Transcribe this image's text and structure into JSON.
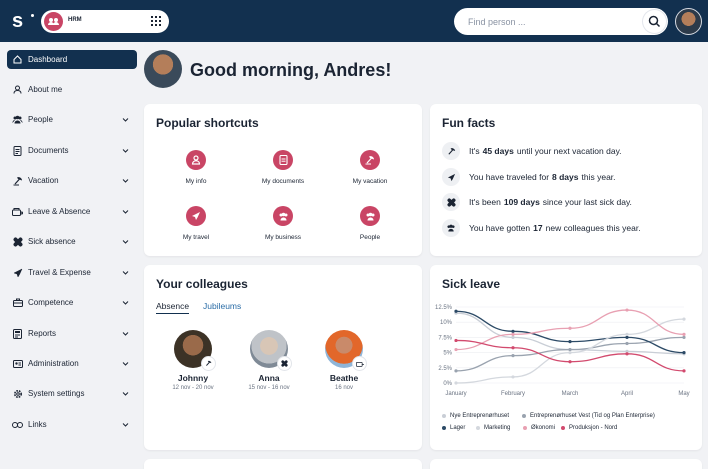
{
  "app": {
    "name": "HRM"
  },
  "search": {
    "placeholder": "Find person ..."
  },
  "sidebar": {
    "items": [
      {
        "label": "Dashboard",
        "icon": "home-icon",
        "active": true
      },
      {
        "label": "About me",
        "icon": "person-icon"
      },
      {
        "label": "People",
        "icon": "people-icon",
        "expandable": true
      },
      {
        "label": "Documents",
        "icon": "document-icon",
        "expandable": true
      },
      {
        "label": "Vacation",
        "icon": "vacation-icon",
        "expandable": true
      },
      {
        "label": "Leave & Absence",
        "icon": "leave-icon",
        "expandable": true
      },
      {
        "label": "Sick absence",
        "icon": "bandage-icon",
        "expandable": true
      },
      {
        "label": "Travel & Expense",
        "icon": "plane-icon",
        "expandable": true
      },
      {
        "label": "Competence",
        "icon": "briefcase-icon",
        "expandable": true
      },
      {
        "label": "Reports",
        "icon": "report-icon",
        "expandable": true
      },
      {
        "label": "Administration",
        "icon": "admin-icon",
        "expandable": true
      },
      {
        "label": "System settings",
        "icon": "gear-icon",
        "expandable": true
      },
      {
        "label": "Links",
        "icon": "link-icon",
        "expandable": true
      }
    ]
  },
  "main": {
    "greeting": "Good morning, Andres!"
  },
  "shortcuts": {
    "title": "Popular shortcuts",
    "items": [
      {
        "label": "My info",
        "icon": "person-icon"
      },
      {
        "label": "My documents",
        "icon": "document-icon"
      },
      {
        "label": "My vacation",
        "icon": "vacation-icon"
      },
      {
        "label": "My travel",
        "icon": "plane-icon"
      },
      {
        "label": "My business",
        "icon": "people-icon"
      },
      {
        "label": "People",
        "icon": "people-icon"
      }
    ]
  },
  "fun_facts": {
    "title": "Fun facts",
    "items": [
      {
        "pre": "It's",
        "bold": "45 days",
        "post": "until your next vacation day.",
        "icon": "vacation-icon"
      },
      {
        "pre": "You have traveled for",
        "bold": "8 days",
        "post": "this year.",
        "icon": "plane-icon"
      },
      {
        "pre": "It's been",
        "bold": "109 days",
        "post": "since your last sick day.",
        "icon": "bandage-icon"
      },
      {
        "pre": "You have gotten",
        "bold": "17",
        "post": "new colleagues this year.",
        "icon": "people-icon"
      }
    ]
  },
  "colleagues": {
    "title": "Your colleagues",
    "tabs": [
      {
        "label": "Absence",
        "active": true
      },
      {
        "label": "Jubileums",
        "active": false
      }
    ],
    "people": [
      {
        "name": "Johnny",
        "dates": "12 nov - 20 nov",
        "badge_icon": "vacation-icon"
      },
      {
        "name": "Anna",
        "dates": "15 nov - 16 nov",
        "badge_icon": "bandage-icon"
      },
      {
        "name": "Beathe",
        "dates": "16 nov",
        "badge_icon": "leave-icon"
      }
    ]
  },
  "sick_leave": {
    "title": "Sick leave"
  },
  "chart_data": {
    "type": "line",
    "title": "Sick leave",
    "x": [
      "January",
      "February",
      "March",
      "April",
      "May"
    ],
    "ylim": [
      0,
      12.5
    ],
    "y_ticks": [
      "0%",
      "2.5%",
      "5%",
      "7.5%",
      "10%",
      "12.5%"
    ],
    "grid": true,
    "legend_position": "bottom",
    "series": [
      {
        "name": "Nye Entreprenørhuset",
        "color": "#c9ced6",
        "values": [
          11.5,
          7.5,
          5.5,
          5.2,
          4.8
        ]
      },
      {
        "name": "Entreprenørhuset Vest (Tid og Plan Enterprise)",
        "color": "#9aa3af",
        "values": [
          2,
          4.5,
          5.5,
          6.5,
          7.5
        ]
      },
      {
        "name": "Lager",
        "color": "#2c4a66",
        "values": [
          11.8,
          8.5,
          6.8,
          7.5,
          5
        ]
      },
      {
        "name": "Marketing",
        "color": "#d4d8de",
        "values": [
          0,
          1,
          5,
          8,
          10.5
        ]
      },
      {
        "name": "Økonomi",
        "color": "#e8a0b2",
        "values": [
          5.5,
          8,
          9,
          12,
          8
        ]
      },
      {
        "name": "Produksjon - Nord",
        "color": "#d24a6e",
        "values": [
          7,
          5.8,
          3.5,
          4.8,
          2
        ]
      }
    ]
  },
  "colors": {
    "navy": "#12304f",
    "accent": "#c94565",
    "link": "#2a6ca6"
  }
}
